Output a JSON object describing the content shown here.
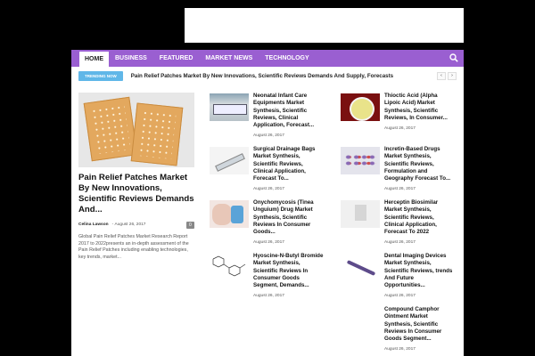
{
  "nav": {
    "items": [
      "HOME",
      "BUSINESS",
      "FEATURED",
      "MARKET NEWS",
      "TECHNOLOGY"
    ]
  },
  "trending": {
    "badge": "TRENDING NOW",
    "headline": "Pain Relief Patches Market By New Innovations, Scientific Reviews Demands And Supply, Forecasts"
  },
  "featured": {
    "title": "Pain Relief Patches Market By New Innovations, Scientific Reviews Demands And...",
    "author": "Celina Lawson",
    "date": "August 26, 2017",
    "comments": "0",
    "excerpt": "Global Pain Relief Patches Market Research Report 2017 to 2022presents an in-depth assessment of the Pain Relief Patches including enabling technologies, key trends, market..."
  },
  "col1": [
    {
      "title": "Neonatal Infant Care Equipments Market Synthesis, Scientific Reviews, Clinical Application, Forecast...",
      "date": "August 26, 2017",
      "thumb": "lab-equipment"
    },
    {
      "title": "Surgical Drainage Bags Market Synthesis, Scientific Reviews, Clinical Application, Forecast To...",
      "date": "August 26, 2017",
      "thumb": "syringe"
    },
    {
      "title": "Onychomycosis (Tinea Unguium) Drug Market Synthesis, Scientific Reviews In Consumer Goods...",
      "date": "August 26, 2017",
      "thumb": "nail-treatment"
    },
    {
      "title": "Hyoscine-N-Butyl Bromide Market Synthesis, Scientific Reviews In Consumer Goods Segment, Demands...",
      "date": "August 26, 2017",
      "thumb": "molecule"
    }
  ],
  "col2": [
    {
      "title": "Thioctic Acid (Alpha Lipoic Acid) Market Synthesis, Scientific Reviews, In Consumer...",
      "date": "August 26, 2017",
      "thumb": "powder-dish"
    },
    {
      "title": "Incretin-Based Drugs Market Synthesis, Scientific Reviews, Formulation and Geography Forecast To...",
      "date": "August 26, 2017",
      "thumb": "pills"
    },
    {
      "title": "Herceptin Biosimilar Market Synthesis, Scientific Reviews, Clinical Application, Forecast To 2022",
      "date": "August 26, 2017",
      "thumb": "document"
    },
    {
      "title": "Dental Imaging Devices Market Synthesis, Scientific Reviews, trends And Future Opportunities...",
      "date": "August 26, 2017",
      "thumb": "dental-probe"
    },
    {
      "title": "Compound Camphor Ointment Market Synthesis, Scientific Reviews In Consumer Goods Segment...",
      "date": "August 26, 2017",
      "thumb": ""
    }
  ]
}
